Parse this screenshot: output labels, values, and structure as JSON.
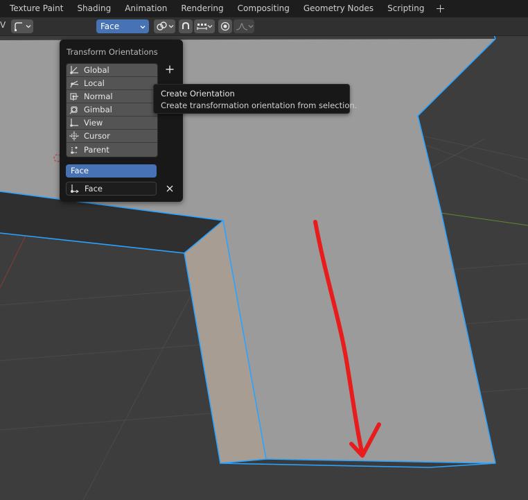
{
  "workspace_tabs": [
    "Texture Paint",
    "Shading",
    "Animation",
    "Rendering",
    "Compositing",
    "Geometry Nodes",
    "Scripting"
  ],
  "header": {
    "left_label": "V",
    "orientation_selected": "Face"
  },
  "orientation_popup": {
    "title": "Transform Orientations",
    "items": [
      {
        "label": "Global",
        "icon": "global-axes-icon"
      },
      {
        "label": "Local",
        "icon": "local-axes-icon"
      },
      {
        "label": "Normal",
        "icon": "normal-axes-icon"
      },
      {
        "label": "Gimbal",
        "icon": "gimbal-icon"
      },
      {
        "label": "View",
        "icon": "view-axes-icon"
      },
      {
        "label": "Cursor",
        "icon": "cursor-axes-icon"
      },
      {
        "label": "Parent",
        "icon": "parent-axes-icon"
      }
    ],
    "custom_active": "Face",
    "name_field_value": "Face"
  },
  "tooltip": {
    "title": "Create Orientation",
    "description": "Create transformation orientation from selection."
  },
  "colors": {
    "accent": "#4772b3",
    "selection_edge": "#29a3ff",
    "annotation": "#e81c1c",
    "mesh_face": "#9b9b9b",
    "side_face": "#a89d92"
  }
}
